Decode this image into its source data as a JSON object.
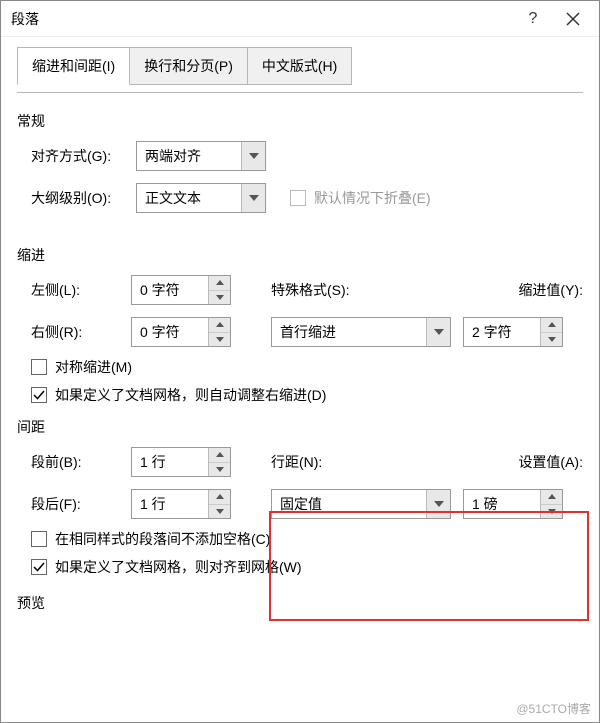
{
  "dialog": {
    "title": "段落",
    "help": "?",
    "close": "✕"
  },
  "tabs": {
    "indent_spacing": "缩进和间距(I)",
    "line_page": "换行和分页(P)",
    "chinese": "中文版式(H)"
  },
  "general": {
    "title": "常规",
    "alignment_label": "对齐方式(G):",
    "alignment_value": "两端对齐",
    "outline_label": "大纲级别(O):",
    "outline_value": "正文文本",
    "collapse_label": "默认情况下折叠(E)"
  },
  "indent": {
    "title": "缩进",
    "left_label": "左侧(L):",
    "left_value": "0 字符",
    "right_label": "右侧(R):",
    "right_value": "0 字符",
    "special_label": "特殊格式(S):",
    "special_value": "首行缩进",
    "by_label": "缩进值(Y):",
    "by_value": "2 字符",
    "mirror_label": "对称缩进(M)",
    "grid_label": "如果定义了文档网格，则自动调整右缩进(D)"
  },
  "spacing": {
    "title": "间距",
    "before_label": "段前(B):",
    "before_value": "1 行",
    "after_label": "段后(F):",
    "after_value": "1 行",
    "line_label": "行距(N):",
    "line_value": "固定值",
    "at_label": "设置值(A):",
    "at_value": "1 磅",
    "nospace_label": "在相同样式的段落间不添加空格(C)",
    "snap_label": "如果定义了文档网格，则对齐到网格(W)"
  },
  "preview": {
    "title": "预览"
  },
  "watermark": "@51CTO博客"
}
